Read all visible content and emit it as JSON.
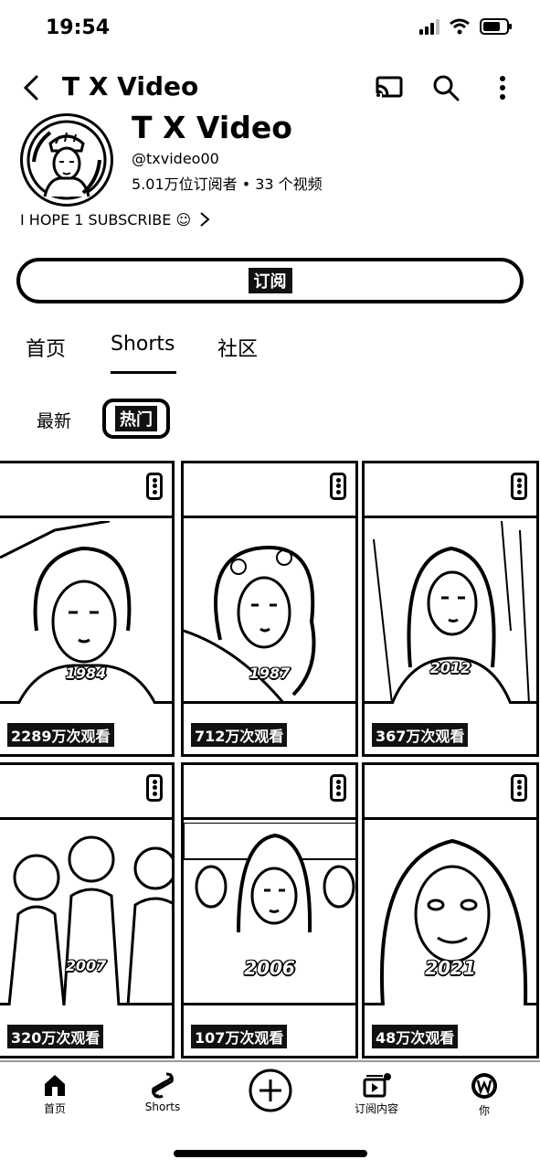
{
  "status": {
    "time": "19:54"
  },
  "topbar": {
    "title": "T X Video",
    "icons": [
      "back-icon",
      "cast-icon",
      "search-icon",
      "more-vert-icon"
    ]
  },
  "channel": {
    "name": "T X Video",
    "handle": "@txvideo00",
    "meta": "5.01万位订阅者 • 33 个视频",
    "description": "I HOPE 1 SUBSCRIBE ☺",
    "subscribe_label": "订阅"
  },
  "tabs": [
    {
      "label": "首页"
    },
    {
      "label": "Shorts",
      "selected": true
    },
    {
      "label": "社区"
    }
  ],
  "chips": [
    {
      "label": "最新"
    },
    {
      "label": "热门",
      "selected": true
    }
  ],
  "shorts": [
    {
      "views": "2289万次观看",
      "year": "1984"
    },
    {
      "views": "712万次观看",
      "year": "1987"
    },
    {
      "views": "367万次观看",
      "year": "2012"
    },
    {
      "views": "320万次观看",
      "year": "2007"
    },
    {
      "views": "107万次观看",
      "year": "2006"
    },
    {
      "views": "48万次观看",
      "year": "2021"
    }
  ],
  "bottom_nav": [
    {
      "label": "首页",
      "icon": "home-icon"
    },
    {
      "label": "Shorts",
      "icon": "shorts-icon"
    },
    {
      "label": "",
      "icon": "create-plus-icon"
    },
    {
      "label": "订阅内容",
      "icon": "subscriptions-icon"
    },
    {
      "label": "你",
      "icon": "profile-avatar-icon"
    }
  ]
}
